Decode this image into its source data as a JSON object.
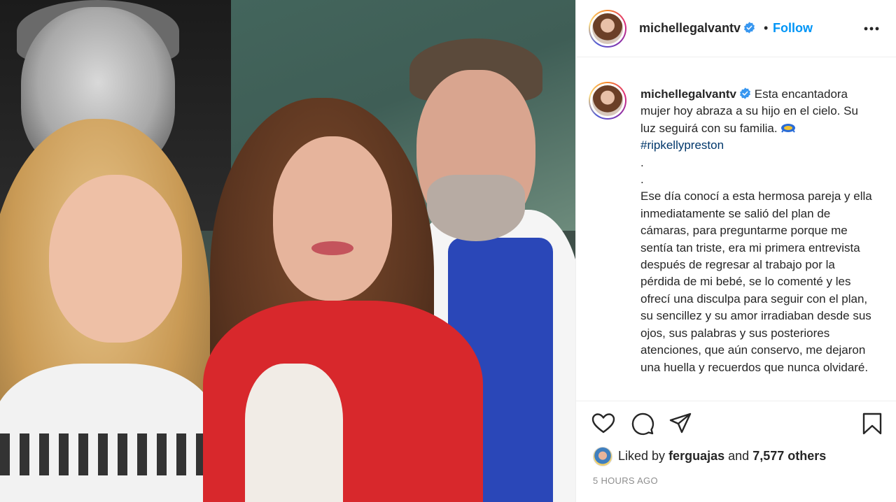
{
  "post": {
    "username": "michellegalvantv",
    "verified": true,
    "dot": "•",
    "follow_label": "Follow",
    "more_icon": "more-horizontal-icon"
  },
  "caption": {
    "username": "michellegalvantv",
    "lines": [
      "Esta encantadora mujer hoy abraza a su hijo en el cielo. Su luz seguirá con su familia.",
      "#ripkellypreston",
      ".",
      ".",
      "Ese día conocí a esta hermosa pareja y ella inmediatamente se salió del plan de cámaras, para preguntarme porque me sentía tan triste, era mi primera entrevista después de regresar al trabajo por la pérdida de mi bebé, se lo comenté y les ofrecí una disculpa para seguir con el plan, su sencillez y su amor irradiaban desde sus ojos, sus palabras y sus posteriores atenciones, que aún conservo, me dejaron una huella y recuerdos que nunca olvidaré."
    ],
    "emoji": "ribbon-angel-emoji"
  },
  "likes": {
    "prefix": "Liked by",
    "user": "ferguajas",
    "middle": "and",
    "others": "7,577 others"
  },
  "timestamp": "5 HOURS AGO",
  "colors": {
    "follow": "#0095f6",
    "hashtag": "#00376b",
    "muted": "#8e8e8e",
    "verified": "#3897f0"
  }
}
